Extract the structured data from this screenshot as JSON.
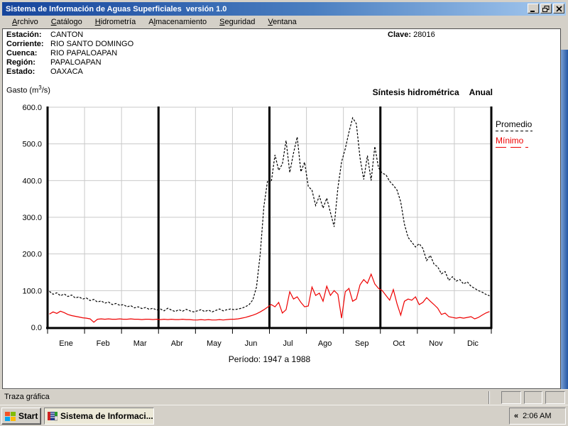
{
  "window": {
    "title": "Sistema de Información de Aguas Superficiales  versión 1.0"
  },
  "menu": {
    "items": [
      {
        "pre": "",
        "key": "A",
        "post": "rchivo"
      },
      {
        "pre": "",
        "key": "C",
        "post": "atálogo"
      },
      {
        "pre": "",
        "key": "H",
        "post": "idrometría"
      },
      {
        "pre": "A",
        "key": "l",
        "post": "macenamiento"
      },
      {
        "pre": "",
        "key": "S",
        "post": "eguridad"
      },
      {
        "pre": "",
        "key": "V",
        "post": "entana"
      }
    ]
  },
  "info": {
    "rows": [
      {
        "label": "Estación:",
        "value": "CANTON"
      },
      {
        "label": "Corriente:",
        "value": "RIO SANTO DOMINGO"
      },
      {
        "label": "Cuenca:",
        "value": "RIO PAPALOAPAN"
      },
      {
        "label": "Región:",
        "value": "PAPALOAPAN"
      },
      {
        "label": "Estado:",
        "value": "OAXACA"
      }
    ],
    "clave_label": "Clave:",
    "clave_value": "28016"
  },
  "chart_header": {
    "unit_prefix": "Gasto (m",
    "unit_sup": "3",
    "unit_suffix": "/s)",
    "title": "Síntesis hidrométrica",
    "mode": "Anual"
  },
  "legend": {
    "promedio": "Promedio",
    "minimo": "Mínimo"
  },
  "periodo": "Período: 1947 a 1988",
  "statusbar": {
    "text": "Traza gráfica"
  },
  "taskbar": {
    "start": "Start",
    "task": "Sistema de Informaci...",
    "chevron": "«",
    "clock": "2:06 AM"
  },
  "colors": {
    "promedio": "#000000",
    "minimo": "#ee0000",
    "grid": "#c9c9c9"
  },
  "chart_data": {
    "type": "line",
    "title": "Síntesis hidrométrica Anual",
    "ylabel": "Gasto (m3/s)",
    "period": "1947 a 1988",
    "ylim": [
      0,
      600
    ],
    "yticks": [
      0,
      100,
      200,
      300,
      400,
      500,
      600
    ],
    "categories": [
      "Ene",
      "Feb",
      "Mar",
      "Abr",
      "May",
      "Jun",
      "Jul",
      "Ago",
      "Sep",
      "Oct",
      "Nov",
      "Dic"
    ],
    "quarter_dividers_after_month": [
      3,
      6,
      9,
      12
    ],
    "grid": true,
    "legend_position": "right",
    "points_per_month": 10,
    "series": [
      {
        "name": "Promedio",
        "style": "dashed",
        "color": "#000000",
        "values": [
          98,
          90,
          94,
          86,
          91,
          84,
          88,
          80,
          83,
          77,
          80,
          73,
          76,
          69,
          72,
          66,
          69,
          62,
          65,
          60,
          62,
          56,
          59,
          53,
          56,
          51,
          54,
          49,
          52,
          47,
          50,
          45,
          52,
          47,
          43,
          48,
          44,
          49,
          45,
          42,
          45,
          48,
          43,
          47,
          42,
          46,
          50,
          45,
          48,
          50,
          48,
          50,
          52,
          56,
          62,
          75,
          110,
          200,
          330,
          400,
          397,
          470,
          428,
          445,
          509,
          422,
          475,
          519,
          424,
          450,
          384,
          374,
          332,
          358,
          325,
          352,
          313,
          274,
          380,
          451,
          487,
          532,
          571,
          555,
          462,
          403,
          468,
          400,
          493,
          435,
          420,
          416,
          398,
          387,
          374,
          342,
          281,
          245,
          232,
          219,
          228,
          215,
          182,
          196,
          172,
          165,
          146,
          152,
          128,
          138,
          126,
          130,
          118,
          124,
          112,
          106,
          100,
          96,
          90,
          86
        ]
      },
      {
        "name": "Mínimo",
        "style": "solid",
        "color": "#ee0000",
        "values": [
          36,
          42,
          38,
          44,
          40,
          35,
          32,
          30,
          28,
          26,
          25,
          23,
          14,
          22,
          23,
          22,
          23,
          22,
          22,
          23,
          22,
          22,
          23,
          22,
          22,
          21,
          22,
          22,
          21,
          22,
          21,
          22,
          21,
          22,
          21,
          21,
          22,
          21,
          21,
          20,
          20,
          21,
          20,
          21,
          20,
          20,
          21,
          20,
          21,
          22,
          22,
          23,
          25,
          27,
          30,
          33,
          37,
          42,
          48,
          55,
          62,
          56,
          68,
          39,
          48,
          97,
          77,
          83,
          68,
          56,
          58,
          110,
          87,
          93,
          71,
          112,
          87,
          100,
          90,
          25,
          97,
          106,
          71,
          77,
          116,
          130,
          120,
          145,
          118,
          106,
          100,
          87,
          74,
          103,
          64,
          33,
          71,
          77,
          74,
          83,
          62,
          68,
          81,
          71,
          62,
          52,
          35,
          39,
          29,
          27,
          25,
          27,
          25,
          27,
          29,
          23,
          27,
          33,
          39,
          43
        ]
      }
    ]
  }
}
